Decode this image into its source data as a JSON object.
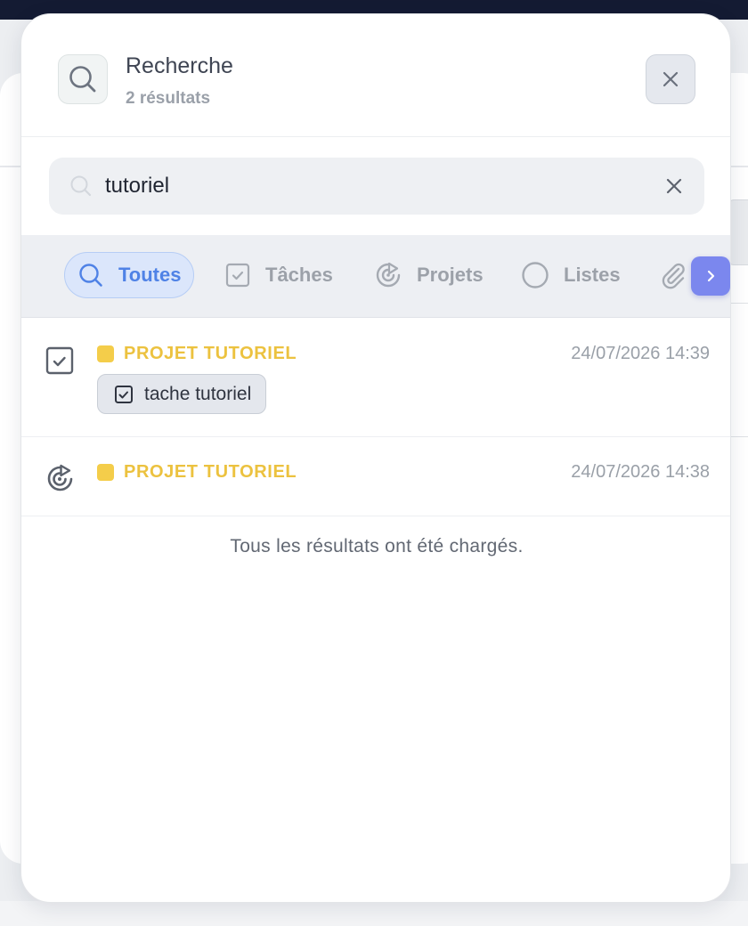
{
  "modal": {
    "title": "Recherche",
    "result_count": "2 résultats"
  },
  "search": {
    "value": "tutoriel",
    "placeholder": ""
  },
  "filters": [
    {
      "label": "Toutes",
      "icon": "search-icon",
      "active": true
    },
    {
      "label": "Tâches",
      "icon": "checkbox-icon",
      "active": false
    },
    {
      "label": "Projets",
      "icon": "target-icon",
      "active": false
    },
    {
      "label": "Listes",
      "icon": "circle-icon",
      "active": false
    },
    {
      "label": "",
      "icon": "paperclip-icon",
      "active": false
    }
  ],
  "results": [
    {
      "type_icon": "checkbox-icon",
      "project": "PROJET TUTORIEL",
      "date": "24/07/2026 14:39",
      "task": "tache tutoriel"
    },
    {
      "type_icon": "target-icon",
      "project": "PROJET TUTORIEL",
      "date": "24/07/2026 14:38"
    }
  ],
  "footer_note": "Tous les résultats ont été chargés.",
  "colors": {
    "accent": "#4f82e6",
    "project": "#f4cd4a",
    "next_button": "#7b87ee"
  }
}
